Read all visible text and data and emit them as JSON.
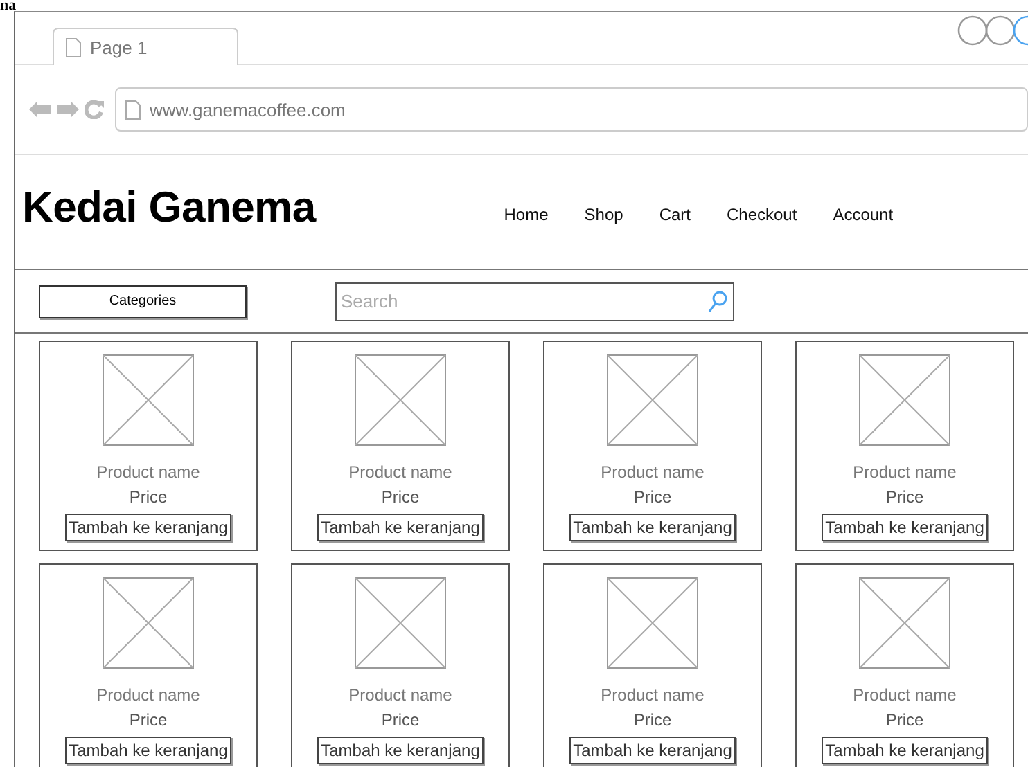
{
  "caption": "na",
  "browser": {
    "tab": "Page 1",
    "url": "www.ganemacoffee.com"
  },
  "site": {
    "title": "Kedai Ganema",
    "nav": [
      "Home",
      "Shop",
      "Cart",
      "Checkout",
      "Account"
    ]
  },
  "toolbar": {
    "categories": "Categories",
    "search": {
      "placeholder": "Search"
    }
  },
  "products": [
    {
      "name": "Product name",
      "price": "Price",
      "button": "Tambah ke keranjang"
    },
    {
      "name": "Product name",
      "price": "Price",
      "button": "Tambah ke keranjang"
    },
    {
      "name": "Product name",
      "price": "Price",
      "button": "Tambah ke keranjang"
    },
    {
      "name": "Product name",
      "price": "Price",
      "button": "Tambah ke keranjang"
    },
    {
      "name": "Product name",
      "price": "Price",
      "button": "Tambah ke keranjang"
    },
    {
      "name": "Product name",
      "price": "Price",
      "button": "Tambah ke keranjang"
    },
    {
      "name": "Product name",
      "price": "Price",
      "button": "Tambah ke keranjang"
    },
    {
      "name": "Product name",
      "price": "Price",
      "button": "Tambah ke keranjang"
    }
  ]
}
